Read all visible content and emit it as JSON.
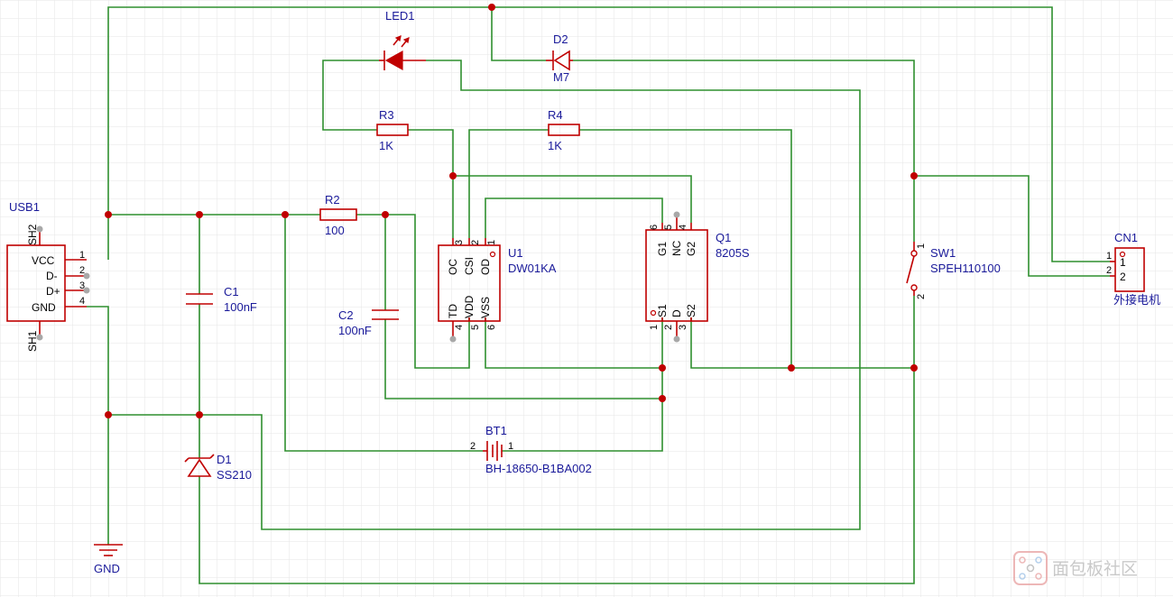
{
  "colors": {
    "wire": "#2f8f2f",
    "part": "#c00000",
    "label": "#1a1a9a",
    "grid": "#e6e6e6"
  },
  "usb1": {
    "ref": "USB1",
    "pins": [
      "VCC",
      "D-",
      "D+",
      "GND"
    ],
    "nums": [
      "1",
      "2",
      "3",
      "4"
    ],
    "sh1": "SH1",
    "sh2": "SH2"
  },
  "c1": {
    "ref": "C1",
    "value": "100nF"
  },
  "c2": {
    "ref": "C2",
    "value": "100nF"
  },
  "r2": {
    "ref": "R2",
    "value": "100"
  },
  "r3": {
    "ref": "R3",
    "value": "1K"
  },
  "r4": {
    "ref": "R4",
    "value": "1K"
  },
  "led1": {
    "ref": "LED1"
  },
  "d2": {
    "ref": "D2",
    "value": "M7"
  },
  "d1": {
    "ref": "D1",
    "value": "SS210"
  },
  "u1": {
    "ref": "U1",
    "value": "DW01KA",
    "top_pins": [
      "OC",
      "CSI",
      "OD"
    ],
    "top_nums": [
      "3",
      "2",
      "1"
    ],
    "bottom_pins": [
      "TD",
      "VDD",
      "VSS"
    ],
    "bottom_nums": [
      "4",
      "5",
      "6"
    ]
  },
  "q1": {
    "ref": "Q1",
    "value": "8205S",
    "top_pins": [
      "G1",
      "NC",
      "G2"
    ],
    "top_nums": [
      "6",
      "5",
      "4"
    ],
    "bottom_pins": [
      "S1",
      "D",
      "S2"
    ],
    "bottom_nums": [
      "1",
      "2",
      "3"
    ]
  },
  "bt1": {
    "ref": "BT1",
    "value": "BH-18650-B1BA002",
    "pin_left": "2",
    "pin_right": "1"
  },
  "sw1": {
    "ref": "SW1",
    "value": "SPEH110100",
    "pin_top": "1",
    "pin_bottom": "2"
  },
  "cn1": {
    "ref": "CN1",
    "value": "外接电机",
    "pins": [
      "1",
      "2"
    ]
  },
  "gnd": {
    "label": "GND"
  },
  "watermark": {
    "text": "面包板社区"
  }
}
